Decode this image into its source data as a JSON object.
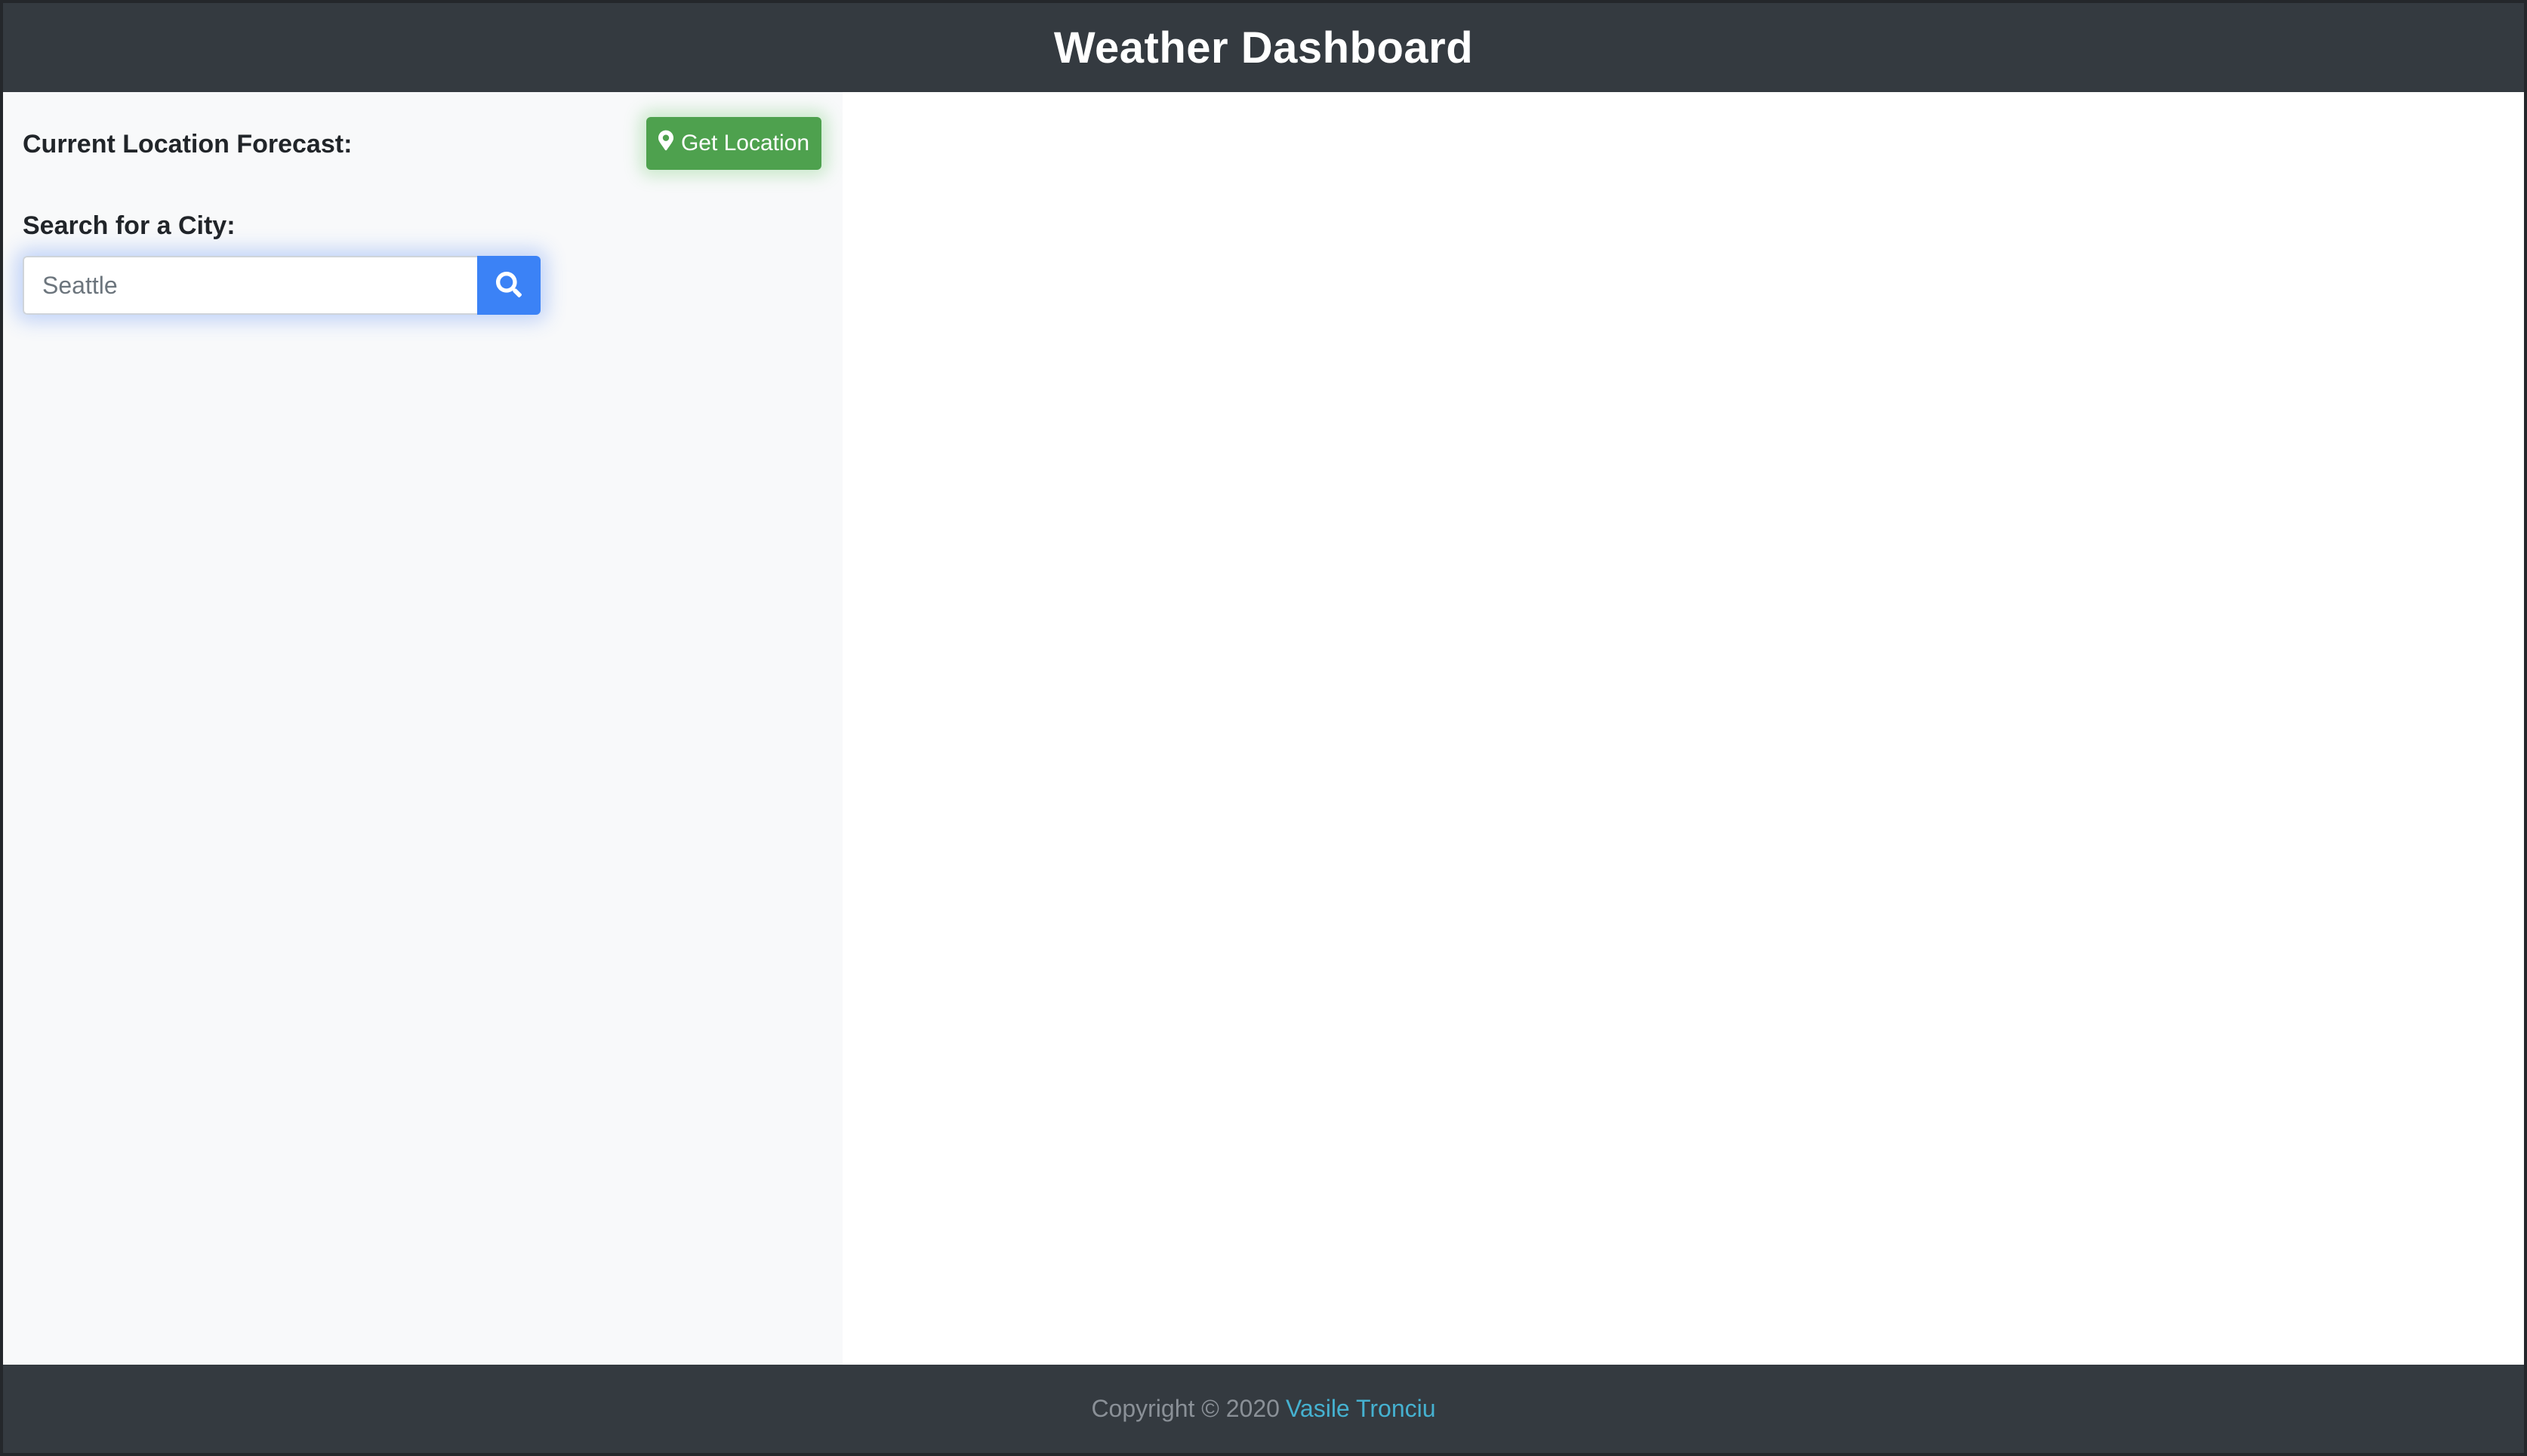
{
  "header": {
    "title": "Weather Dashboard"
  },
  "sidebar": {
    "current_location_label": "Current Location Forecast:",
    "get_location_button": {
      "label": "Get Location",
      "icon": "map-marker-icon"
    },
    "search": {
      "label": "Search for a City:",
      "placeholder": "Seattle",
      "button_icon": "search-icon"
    }
  },
  "footer": {
    "copyright_text": "Copyright © 2020",
    "author_link": "Vasile Tronciu"
  },
  "colors": {
    "header_bg": "#343a40",
    "sidebar_bg": "#f8f9fa",
    "get_location_green": "#4ea14e",
    "search_blue": "#3b82f6",
    "link_color": "#45b1d0"
  }
}
